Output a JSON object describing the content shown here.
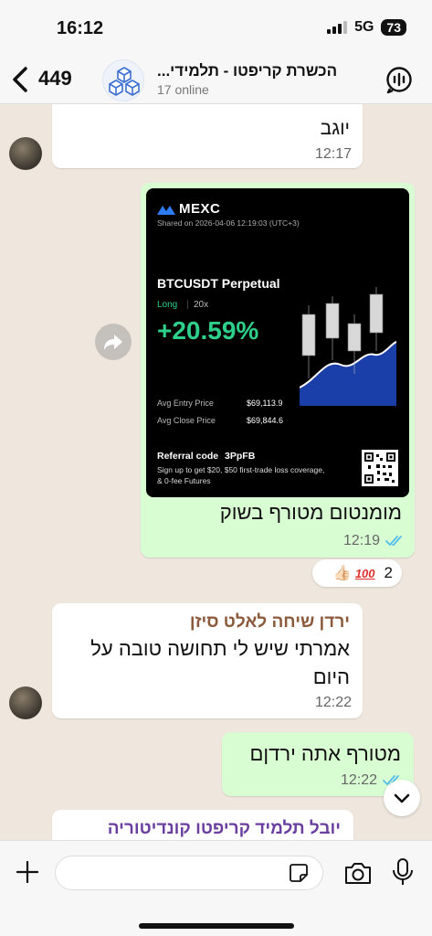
{
  "status_bar": {
    "time": "16:12",
    "network": "5G",
    "battery": "73"
  },
  "header": {
    "unread_count": "449",
    "title": "הכשרת קריפטו - תלמידי...",
    "subtitle": "17 online"
  },
  "messages": [
    {
      "partial_text": "יוגב",
      "time": "12:17"
    },
    {
      "card": {
        "brand": "MEXC",
        "shared": "Shared on 2026-04-06 12:19:03 (UTC+3)",
        "pair": "BTCUSDT Perpetual",
        "side": "Long",
        "leverage": "20x",
        "pnl": "+20.59%",
        "entry_label": "Avg Entry Price",
        "entry_value": "$69,113.9",
        "close_label": "Avg Close Price",
        "close_value": "$69,844.6",
        "referral_label": "Referral code",
        "referral_code": "3PpFB",
        "promo": "Sign up to get $20, $50 first-trade loss coverage, & 0-fee Futures"
      },
      "text": "מומנטום מטורף בשוק",
      "time": "12:19",
      "reactions": {
        "count": "2",
        "emoji_1": "👍🏻",
        "emoji_2": "100"
      }
    },
    {
      "sender": "ירדן שיחה לאלט סיזן",
      "text": "אמרתי שיש לי תחושה טובה על היום",
      "time": "12:22"
    },
    {
      "text": "מטורף אתה ירדןם",
      "time": "12:22"
    },
    {
      "sender": "יובל תלמיד קריפטו קונדיטוריה"
    }
  ],
  "composer": {
    "placeholder": ""
  },
  "colors": {
    "outgoing": "#d9fdd3",
    "incoming": "#ffffff",
    "pnl_green": "#2ecf8a",
    "sender_1": "#8b5a3c",
    "sender_2": "#6b3fa0",
    "read_ticks": "#53bdeb"
  }
}
